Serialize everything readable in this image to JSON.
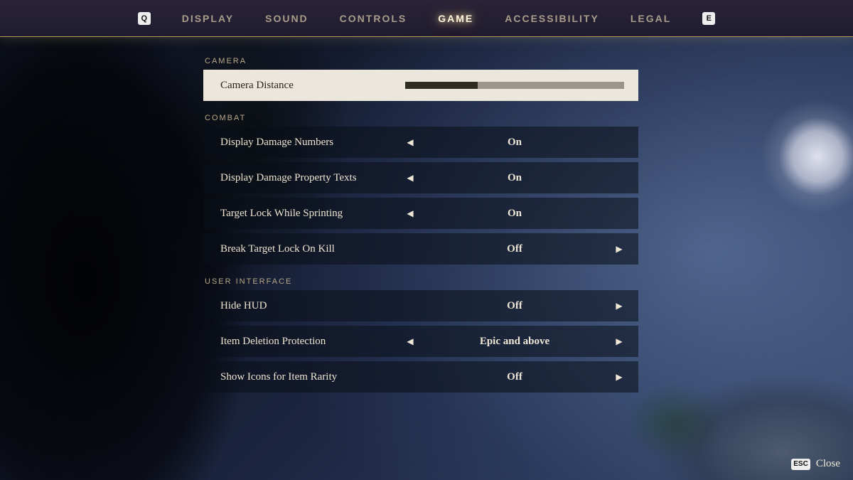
{
  "nav": {
    "prev_key": "Q",
    "next_key": "E",
    "tabs": [
      "DISPLAY",
      "SOUND",
      "CONTROLS",
      "GAME",
      "ACCESSIBILITY",
      "LEGAL"
    ],
    "active": "GAME"
  },
  "sections": {
    "camera": {
      "title": "CAMERA",
      "camera_distance": {
        "label": "Camera Distance",
        "percent": 33
      }
    },
    "combat": {
      "title": "COMBAT",
      "damage_numbers": {
        "label": "Display Damage Numbers",
        "value": "On",
        "left": true,
        "right": false
      },
      "damage_property": {
        "label": "Display Damage Property Texts",
        "value": "On",
        "left": true,
        "right": false
      },
      "target_lock_sprint": {
        "label": "Target Lock While Sprinting",
        "value": "On",
        "left": true,
        "right": false
      },
      "break_lock_kill": {
        "label": "Break Target Lock On Kill",
        "value": "Off",
        "left": false,
        "right": true
      }
    },
    "ui": {
      "title": "USER INTERFACE",
      "hide_hud": {
        "label": "Hide HUD",
        "value": "Off",
        "left": false,
        "right": true
      },
      "item_delete": {
        "label": "Item Deletion Protection",
        "value": "Epic and above",
        "left": true,
        "right": true
      },
      "item_rarity": {
        "label": "Show Icons for Item Rarity",
        "value": "Off",
        "left": false,
        "right": true
      }
    }
  },
  "footer": {
    "close_key": "ESC",
    "close_label": "Close"
  }
}
